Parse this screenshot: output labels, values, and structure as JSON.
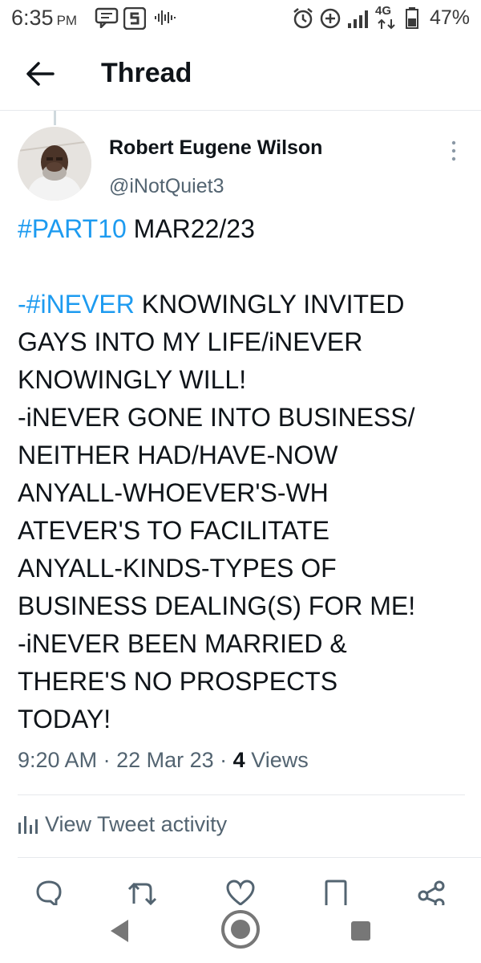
{
  "status_bar": {
    "time": "6:35",
    "ampm": "PM",
    "network": "4G",
    "battery": "47%"
  },
  "header": {
    "title": "Thread"
  },
  "tweet": {
    "author_name": "Robert Eugene Wilson",
    "handle": "@iNotQuiet3",
    "text_lines": [
      {
        "tag": "#PART10",
        "text": " MAR22/23"
      },
      {
        "tag": "-#iNEVER",
        "text": " KNOWINGLY INVITED"
      },
      {
        "text": "GAYS INTO MY LIFE/iNEVER"
      },
      {
        "text": "KNOWINGLY WILL!"
      },
      {
        "text": "-iNEVER GONE INTO BUSINESS/"
      },
      {
        "text": "NEITHER HAD/HAVE-NOW"
      },
      {
        "text": "ANYALL-WHOEVER'S-WH"
      },
      {
        "text": "ATEVER'S TO FACILITATE"
      },
      {
        "text": "ANYALL-KINDS-TYPES OF"
      },
      {
        "text": "BUSINESS DEALING(S) FOR ME!"
      },
      {
        "text": "-iNEVER BEEN MARRIED &"
      },
      {
        "text": "THERE'S NO PROSPECTS"
      },
      {
        "text": "TODAY!"
      }
    ],
    "time": "9:20 AM",
    "date": "22 Mar 23",
    "views_count": "4",
    "views_label": "Views",
    "activity_label": "View Tweet activity"
  },
  "icons": {
    "back": "arrow-left-icon",
    "more": "more-vertical-icon",
    "reply": "reply-icon",
    "retweet": "retweet-icon",
    "like": "heart-icon",
    "bookmark": "bookmark-icon",
    "share": "share-icon",
    "activity": "bar-chart-icon"
  },
  "colors": {
    "link": "#1d9bf0",
    "text": "#0f1419",
    "secondary": "#536471",
    "divider": "#e6e9ec"
  }
}
